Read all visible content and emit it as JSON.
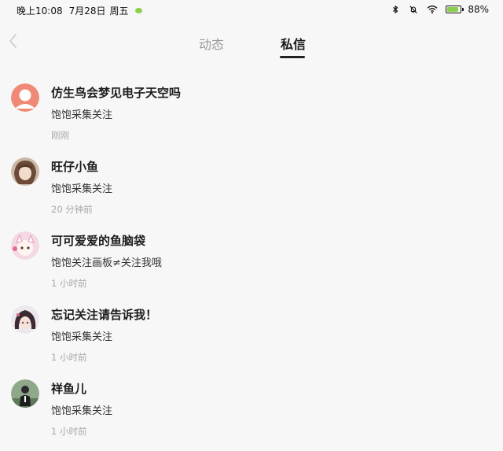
{
  "status_bar": {
    "time": "晚上10:08",
    "date": "7月28日",
    "weekday": "周五",
    "battery": "88%",
    "battery_level": 0.88,
    "icons": [
      "wechat-icon",
      "bluetooth-icon",
      "mute-icon",
      "wifi-icon",
      "battery-icon"
    ]
  },
  "header": {
    "back_icon": "chevron-left-icon",
    "tabs": [
      {
        "label": "动态",
        "active": false
      },
      {
        "label": "私信",
        "active": true
      }
    ]
  },
  "messages": [
    {
      "name": "仿生鸟会梦见电子天空吗",
      "text": "饱饱采集关注",
      "time": "刚刚",
      "avatar": "default-avatar-icon"
    },
    {
      "name": "旺仔小鱼",
      "text": "饱饱采集关注",
      "time": "20 分钟前",
      "avatar": "user-avatar"
    },
    {
      "name": "可可爱爱的鱼脑袋",
      "text": "饱饱关注画板≠关注我哦",
      "time": "1 小时前",
      "avatar": "user-avatar"
    },
    {
      "name": "忘记关注请告诉我！",
      "text": "饱饱采集关注",
      "time": "1 小时前",
      "avatar": "user-avatar"
    },
    {
      "name": "祥鱼儿",
      "text": "饱饱采集关注",
      "time": "1 小时前",
      "avatar": "user-avatar"
    }
  ],
  "colors": {
    "background": "#f7f7f7",
    "default_avatar": "#f08a77",
    "battery_fill": "#8bd04a"
  }
}
